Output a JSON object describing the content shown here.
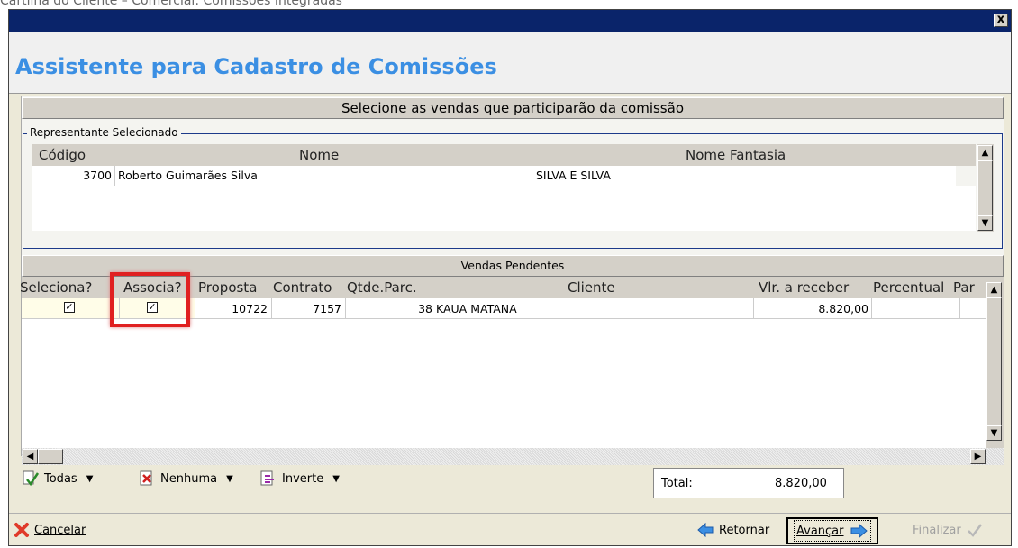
{
  "caption": "Cartilha do Cliente – Comercial: Comissões Integradas",
  "window": {
    "close_label": "x"
  },
  "header": {
    "title": "Assistente para Cadastro de Comissões"
  },
  "section_title": "Selecione as vendas que participarão da comissão",
  "representante": {
    "group_label": "Representante Selecionado",
    "columns": {
      "codigo": "Código",
      "nome": "Nome",
      "fantasia": "Nome Fantasia"
    },
    "row": {
      "codigo": "3700",
      "nome": "Roberto Guimarães Silva",
      "fantasia": "SILVA E SILVA"
    }
  },
  "vendas": {
    "title": "Vendas Pendentes",
    "columns": {
      "seleciona": "Seleciona?",
      "associa": "Associa?",
      "proposta": "Proposta",
      "contrato": "Contrato",
      "qtde": "Qtde.Parc.",
      "cliente": "Cliente",
      "vlr": "Vlr. a receber",
      "percentual": "Percentual",
      "par": "Par"
    },
    "row": {
      "seleciona": true,
      "associa": true,
      "proposta": "10722",
      "contrato": "7157",
      "qtde": "38",
      "cliente": "KAUA MATANA",
      "vlr": "8.820,00",
      "percentual": "",
      "par": ""
    }
  },
  "toolbar": {
    "todas": "Todas",
    "nenhuma": "Nenhuma",
    "inverte": "Inverte",
    "total_label": "Total:",
    "total_value": "8.820,00"
  },
  "footer": {
    "cancelar": "Cancelar",
    "retornar": "Retornar",
    "avancar": "Avançar",
    "finalizar": "Finalizar"
  },
  "colors": {
    "title": "#3b8fe3",
    "titlebar": "#0a246a",
    "highlight": "#e02020",
    "selected_row": "#fffde8"
  }
}
